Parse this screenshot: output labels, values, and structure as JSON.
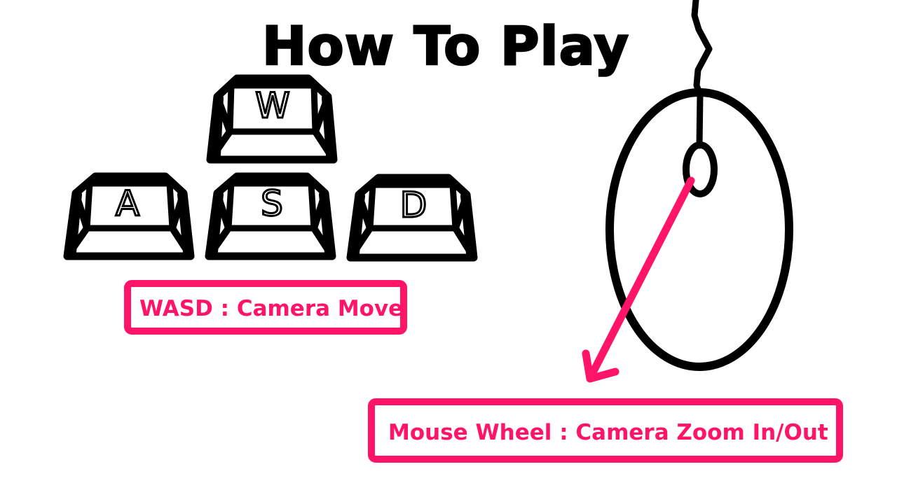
{
  "title": "How To Play",
  "keys": {
    "w": "W",
    "a": "A",
    "s": "S",
    "d": "D"
  },
  "controls": {
    "wasd_label": "WASD : Camera Move",
    "wheel_label": "Mouse Wheel : Camera Zoom In/Out"
  },
  "icons": {
    "keyboard": "wasd-keys-icon",
    "mouse": "mouse-icon",
    "arrow": "pointer-arrow-icon"
  },
  "colors": {
    "accent": "#ff1467",
    "ink": "#000000",
    "background": "#ffffff"
  }
}
